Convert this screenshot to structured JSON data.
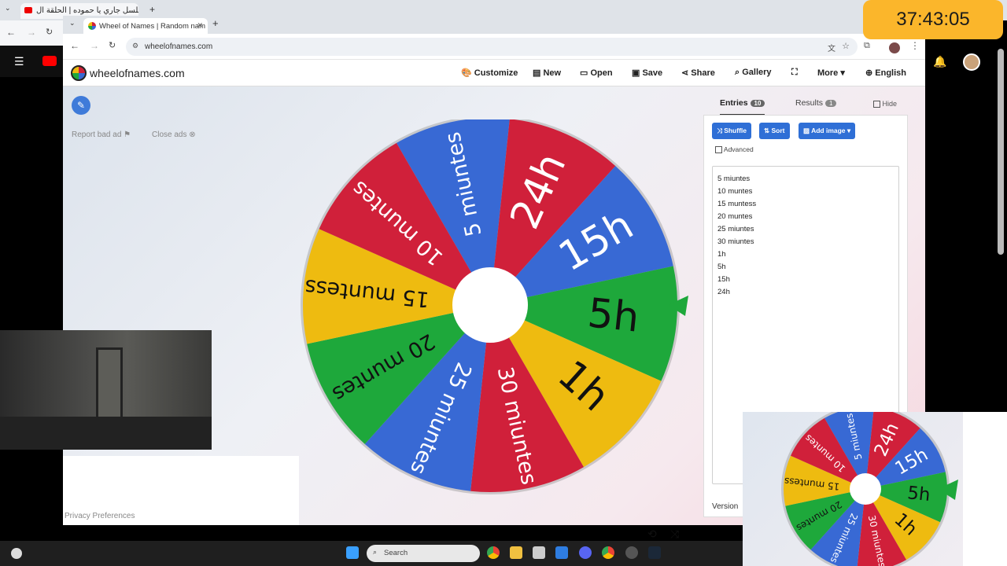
{
  "outer_browser": {
    "tab_title": "مسلسل جاري يا حموده | الحلقة ال"
  },
  "inner_browser": {
    "tab_title": "Wheel of Names | Random nam",
    "url": "wheelofnames.com"
  },
  "header": {
    "brand": "wheelofnames.com",
    "menu": [
      "Customize",
      "New",
      "Open",
      "Save",
      "Share",
      "Gallery",
      "More",
      "English"
    ]
  },
  "left_tools": {
    "report": "Report bad ad",
    "close_ads": "Close ads"
  },
  "panel": {
    "tab_entries": "Entries",
    "entries_count": "10",
    "tab_results": "Results",
    "results_count": "1",
    "hide_label": "Hide",
    "shuffle_label": "Shuffle",
    "sort_label": "Sort",
    "add_image_label": "Add image",
    "advanced_label": "Advanced",
    "version_label": "Version"
  },
  "entries": [
    "5 miuntes",
    "10 muntes",
    "15 muntess",
    "20 muntes",
    "25 miuntes",
    "30 miuntes",
    "1h",
    "5h",
    "15h",
    "24h"
  ],
  "wheel": {
    "slices": [
      {
        "label": "5 miuntes",
        "color": "#3869d4"
      },
      {
        "label": "24h",
        "color": "#d0203a"
      },
      {
        "label": "15h",
        "color": "#3869d4"
      },
      {
        "label": "5h",
        "color": "#1ea83b"
      },
      {
        "label": "1h",
        "color": "#eebb10"
      },
      {
        "label": "30 miuntes",
        "color": "#d0203a"
      },
      {
        "label": "25 miuntes",
        "color": "#3869d4"
      },
      {
        "label": "20 muntes",
        "color": "#1ea83b"
      },
      {
        "label": "15 muntess",
        "color": "#eebb10"
      },
      {
        "label": "10 muntes",
        "color": "#d0203a"
      }
    ],
    "pointer_color": "#1ea83b"
  },
  "footer": {
    "privacy": "Privacy Preferences"
  },
  "taskbar": {
    "search": "Search"
  },
  "timer": "37:43:05"
}
